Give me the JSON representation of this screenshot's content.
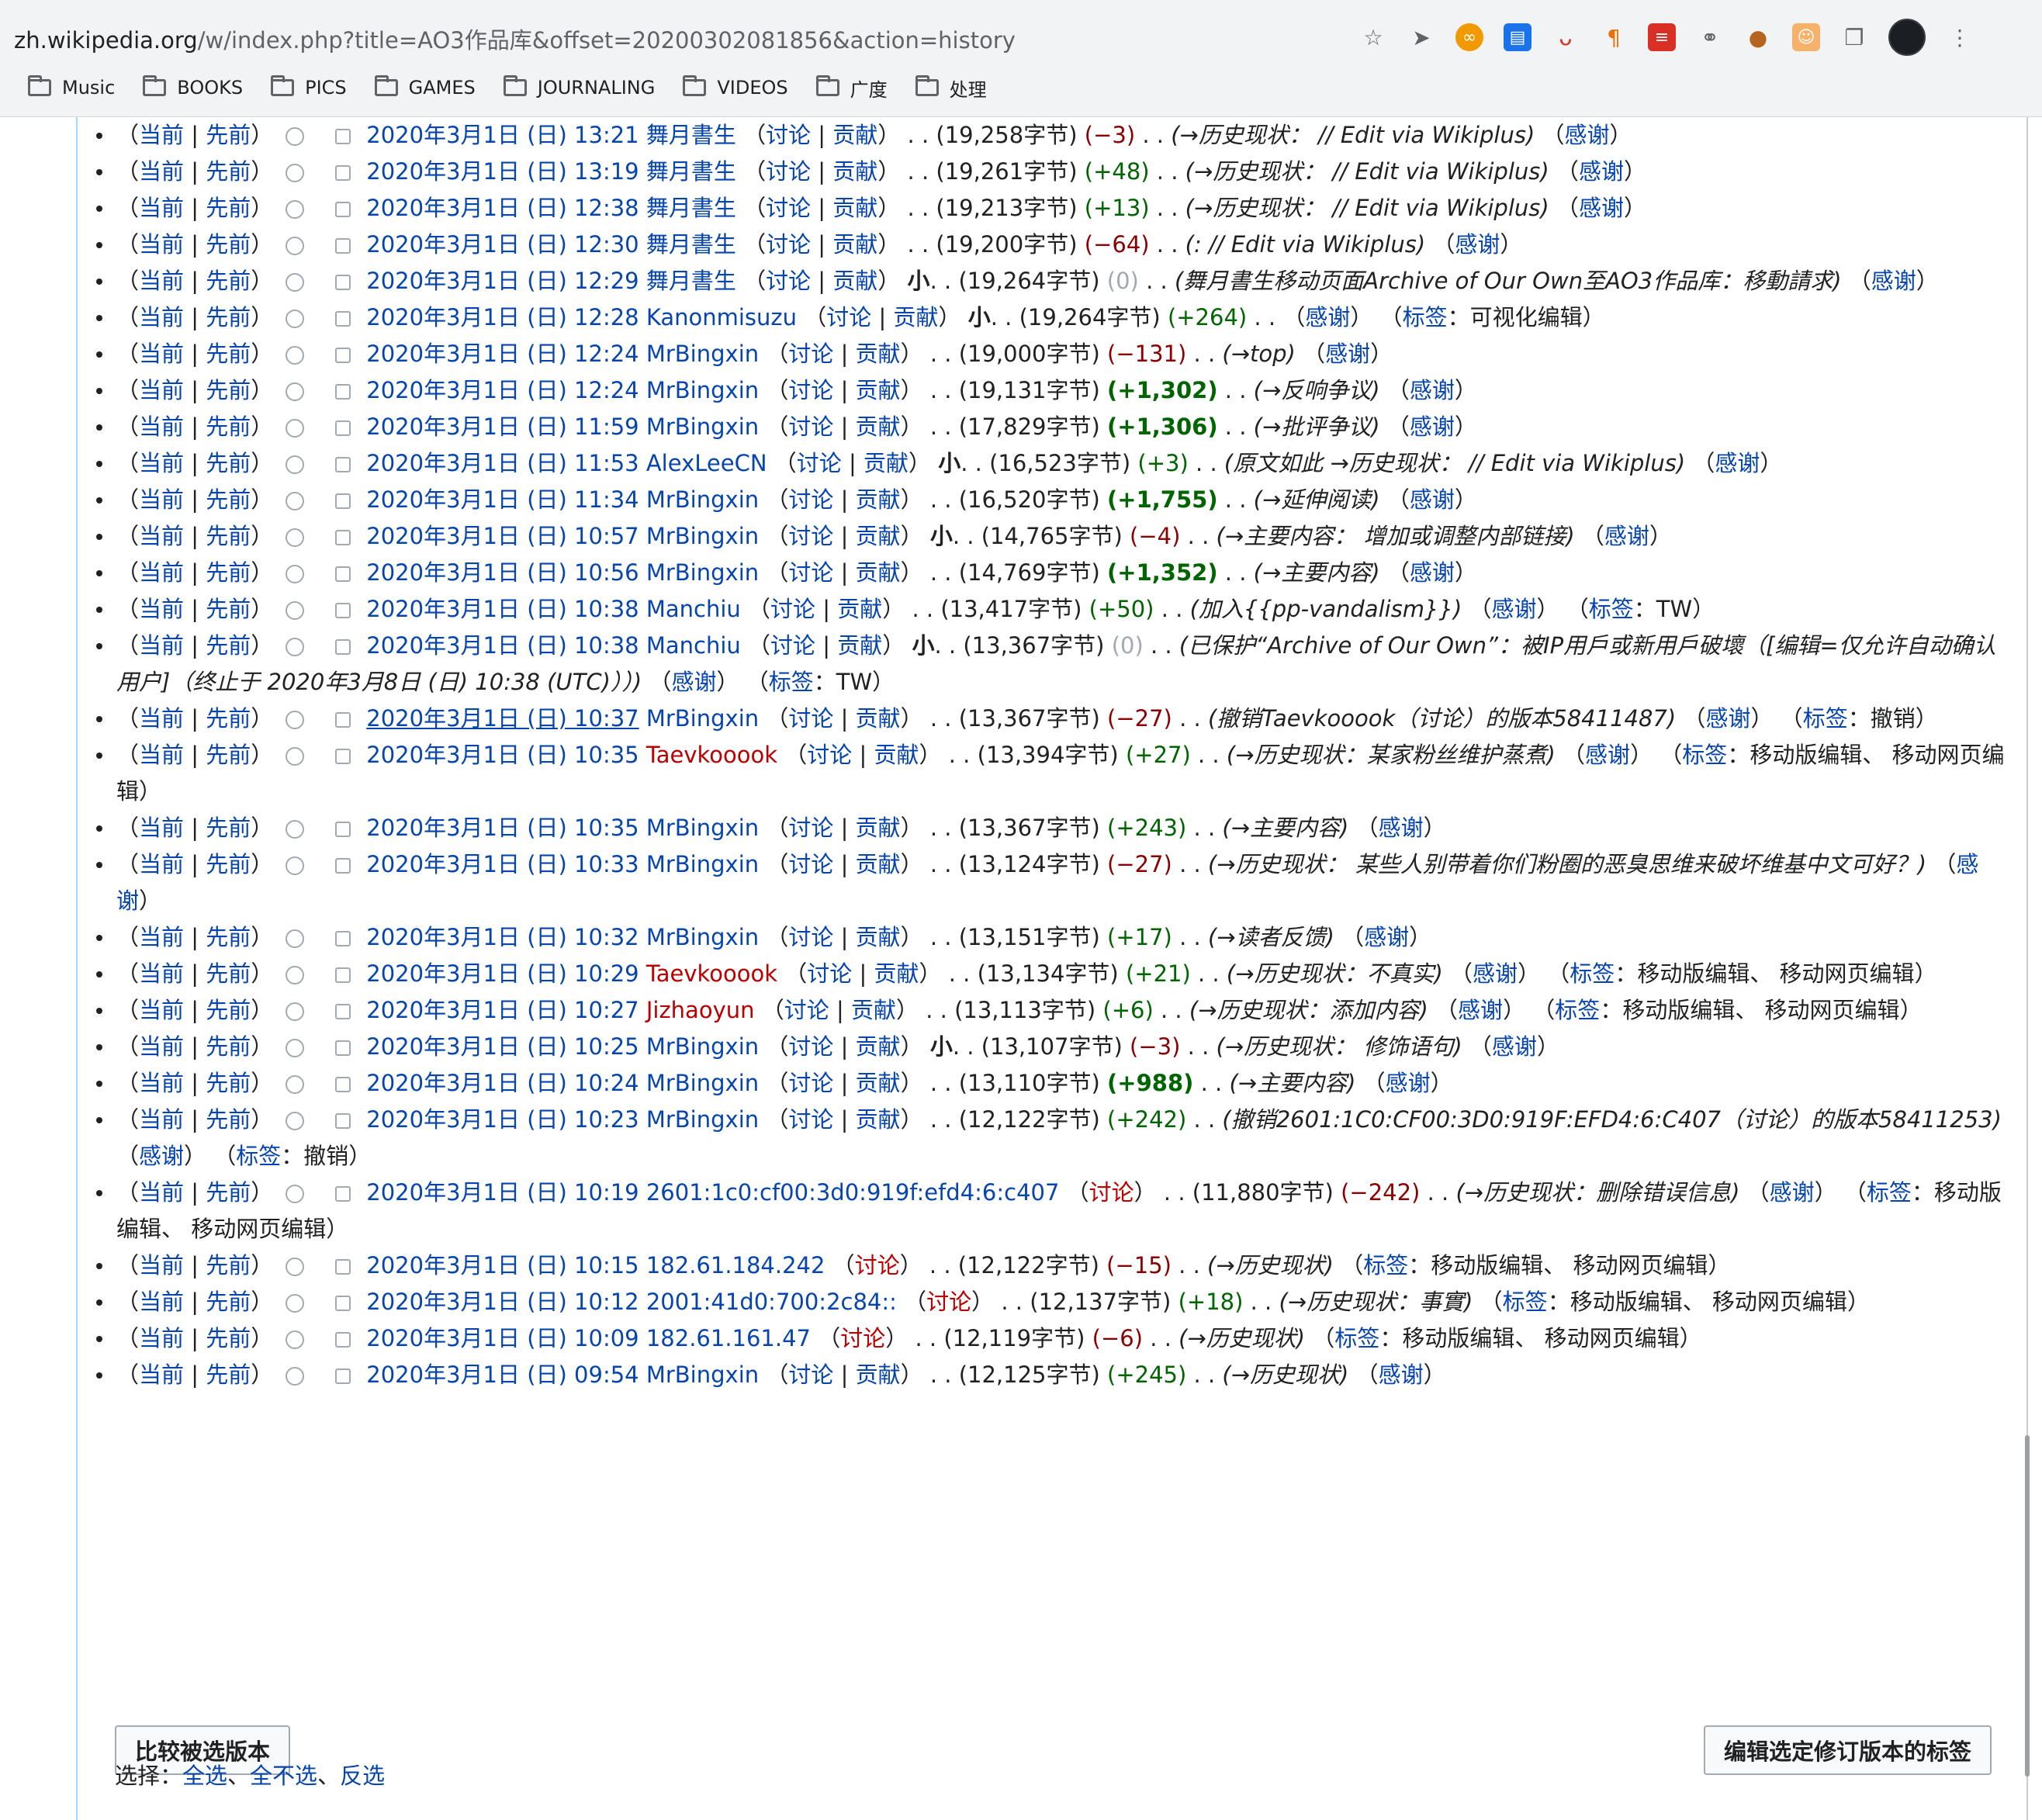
{
  "browser": {
    "url_host": "zh.wikipedia.org",
    "url_path": "/w/index.php?title=AO3作品库&offset=20200302081856&action=history",
    "bookmarks": [
      "Music",
      "BOOKS",
      "PICS",
      "GAMES",
      "JOURNALING",
      "VIDEOS",
      "广度",
      "处理"
    ]
  },
  "labels": {
    "cur": "当前",
    "prev": "先前",
    "talk": "讨论",
    "contribs": "贡献",
    "thank": "感谢",
    "minor": "小",
    "tags": "标签"
  },
  "rows": [
    {
      "date": "2020年3月1日 (日) 13:21",
      "user": "舞月書生",
      "size": "(19,258字节)",
      "diff": "(−3)",
      "diff_type": "neg",
      "comment": "(→历史现状： // Edit via Wikiplus)"
    },
    {
      "date": "2020年3月1日 (日) 13:19",
      "user": "舞月書生",
      "size": "(19,261字节)",
      "diff": "(+48)",
      "diff_type": "pos",
      "comment": "(→历史现状： // Edit via Wikiplus)"
    },
    {
      "date": "2020年3月1日 (日) 12:38",
      "user": "舞月書生",
      "size": "(19,213字节)",
      "diff": "(+13)",
      "diff_type": "pos",
      "comment": "(→历史现状： // Edit via Wikiplus)"
    },
    {
      "date": "2020年3月1日 (日) 12:30",
      "user": "舞月書生",
      "size": "(19,200字节)",
      "diff": "(−64)",
      "diff_type": "neg",
      "comment": "(: // Edit via Wikiplus)"
    },
    {
      "date": "2020年3月1日 (日) 12:29",
      "user": "舞月書生",
      "minor": true,
      "size": "(19,264字节)",
      "diff": "(0)",
      "diff_type": "zero",
      "comment": "(舞月書生移动页面Archive of Our Own至AO3作品库：移動請求)"
    },
    {
      "date": "2020年3月1日 (日) 12:28",
      "user": "Kanonmisuzu",
      "minor": true,
      "size": "(19,264字节)",
      "diff": "(+264)",
      "diff_type": "pos",
      "comment": "",
      "tags": "可视化编辑"
    },
    {
      "date": "2020年3月1日 (日) 12:24",
      "user": "MrBingxin",
      "size": "(19,000字节)",
      "diff": "(−131)",
      "diff_type": "neg",
      "comment": "(→top)"
    },
    {
      "date": "2020年3月1日 (日) 12:24",
      "user": "MrBingxin",
      "size": "(19,131字节)",
      "diff": "(+1,302)",
      "diff_type": "pos-big",
      "comment": "(→反响争议)"
    },
    {
      "date": "2020年3月1日 (日) 11:59",
      "user": "MrBingxin",
      "size": "(17,829字节)",
      "diff": "(+1,306)",
      "diff_type": "pos-big",
      "comment": "(→批评争议)"
    },
    {
      "date": "2020年3月1日 (日) 11:53",
      "user": "AlexLeeCN",
      "minor": true,
      "size": "(16,523字节)",
      "diff": "(+3)",
      "diff_type": "pos",
      "comment": "(原文如此 →历史现状： // Edit via Wikiplus)"
    },
    {
      "date": "2020年3月1日 (日) 11:34",
      "user": "MrBingxin",
      "size": "(16,520字节)",
      "diff": "(+1,755)",
      "diff_type": "pos-big",
      "comment": "(→延伸阅读)"
    },
    {
      "date": "2020年3月1日 (日) 10:57",
      "user": "MrBingxin",
      "minor": true,
      "size": "(14,765字节)",
      "diff": "(−4)",
      "diff_type": "neg",
      "comment": "(→主要内容： 增加或调整内部链接)"
    },
    {
      "date": "2020年3月1日 (日) 10:56",
      "user": "MrBingxin",
      "size": "(14,769字节)",
      "diff": "(+1,352)",
      "diff_type": "pos-big",
      "comment": "(→主要内容)"
    },
    {
      "date": "2020年3月1日 (日) 10:38",
      "user": "Manchiu",
      "size": "(13,417字节)",
      "diff": "(+50)",
      "diff_type": "pos",
      "comment": "(加入{{pp-vandalism}})",
      "tags": "TW"
    },
    {
      "date": "2020年3月1日 (日) 10:38",
      "user": "Manchiu",
      "minor": true,
      "size": "(13,367字节)",
      "diff": "(0)",
      "diff_type": "zero",
      "comment": "(已保护“Archive of Our Own”：被IP用戶或新用戶破壞（[编辑=仅允许自动确认用户]（终止于 2020年3月8日 (日) 10:38 (UTC)））)",
      "tags": "TW"
    },
    {
      "date": "2020年3月1日 (日) 10:37",
      "user": "MrBingxin",
      "size": "(13,367字节)",
      "diff": "(−27)",
      "diff_type": "neg",
      "comment": "(撤销Taevkooook（讨论）的版本58411487)",
      "tags": "撤销",
      "underline": true
    },
    {
      "date": "2020年3月1日 (日) 10:35",
      "user": "Taevkooook",
      "redlink": true,
      "size": "(13,394字节)",
      "diff": "(+27)",
      "diff_type": "pos",
      "comment": "(→历史现状：某家粉丝维护蒸煮)",
      "tags": "移动版编辑、 移动网页编辑"
    },
    {
      "date": "2020年3月1日 (日) 10:35",
      "user": "MrBingxin",
      "size": "(13,367字节)",
      "diff": "(+243)",
      "diff_type": "pos",
      "comment": "(→主要内容)"
    },
    {
      "date": "2020年3月1日 (日) 10:33",
      "user": "MrBingxin",
      "size": "(13,124字节)",
      "diff": "(−27)",
      "diff_type": "neg",
      "comment": "(→历史现状： 某些人别带着你们粉圈的恶臭思维来破坏维基中文可好？)"
    },
    {
      "date": "2020年3月1日 (日) 10:32",
      "user": "MrBingxin",
      "size": "(13,151字节)",
      "diff": "(+17)",
      "diff_type": "pos",
      "comment": "(→读者反馈)"
    },
    {
      "date": "2020年3月1日 (日) 10:29",
      "user": "Taevkooook",
      "redlink": true,
      "size": "(13,134字节)",
      "diff": "(+21)",
      "diff_type": "pos",
      "comment": "(→历史现状：不真实)",
      "tags": "移动版编辑、 移动网页编辑"
    },
    {
      "date": "2020年3月1日 (日) 10:27",
      "user": "Jizhaoyun",
      "redlink": true,
      "size": "(13,113字节)",
      "diff": "(+6)",
      "diff_type": "pos",
      "comment": "(→历史现状：添加内容)",
      "tags": "移动版编辑、 移动网页编辑"
    },
    {
      "date": "2020年3月1日 (日) 10:25",
      "user": "MrBingxin",
      "minor": true,
      "size": "(13,107字节)",
      "diff": "(−3)",
      "diff_type": "neg",
      "comment": "(→历史现状： 修饰语句)"
    },
    {
      "date": "2020年3月1日 (日) 10:24",
      "user": "MrBingxin",
      "size": "(13,110字节)",
      "diff": "(+988)",
      "diff_type": "pos-big",
      "comment": "(→主要内容)"
    },
    {
      "date": "2020年3月1日 (日) 10:23",
      "user": "MrBingxin",
      "size": "(12,122字节)",
      "diff": "(+242)",
      "diff_type": "pos",
      "comment": "(撤销2601:1C0:CF00:3D0:919F:EFD4:6:C407（讨论）的版本58411253)",
      "tags": "撤销"
    },
    {
      "date": "2020年3月1日 (日) 10:19",
      "user": "2601:1c0:cf00:3d0:919f:efd4:6:c407",
      "anon": true,
      "size": "(11,880字节)",
      "diff": "(−242)",
      "diff_type": "neg",
      "comment": "(→历史现状：删除错误信息)",
      "tags": "移动版编辑、 移动网页编辑"
    },
    {
      "date": "2020年3月1日 (日) 10:15",
      "user": "182.61.184.242",
      "anon": true,
      "size": "(12,122字节)",
      "diff": "(−15)",
      "diff_type": "neg",
      "comment": "(→历史现状)",
      "tags": "移动版编辑、 移动网页编辑",
      "no_thank": true
    },
    {
      "date": "2020年3月1日 (日) 10:12",
      "user": "2001:41d0:700:2c84::",
      "anon": true,
      "size": "(12,137字节)",
      "diff": "(+18)",
      "diff_type": "pos",
      "comment": "(→历史现状：事實)",
      "tags": "移动版编辑、 移动网页编辑",
      "no_thank": true
    },
    {
      "date": "2020年3月1日 (日) 10:09",
      "user": "182.61.161.47",
      "anon": true,
      "size": "(12,119字节)",
      "diff": "(−6)",
      "diff_type": "neg",
      "comment": "(→历史现状)",
      "tags": "移动版编辑、 移动网页编辑",
      "no_thank": true
    },
    {
      "date": "2020年3月1日 (日) 09:54",
      "user": "MrBingxin",
      "size": "(12,125字节)",
      "diff": "(+245)",
      "diff_type": "pos",
      "comment": "(→历史现状)"
    }
  ],
  "buttons": {
    "compare": "比较被选版本",
    "edit_tags": "编辑选定修订版本的标签"
  },
  "select": {
    "label": "选择：",
    "all": "全选",
    "none": "全不选",
    "invert": "反选",
    "sep": "、"
  }
}
